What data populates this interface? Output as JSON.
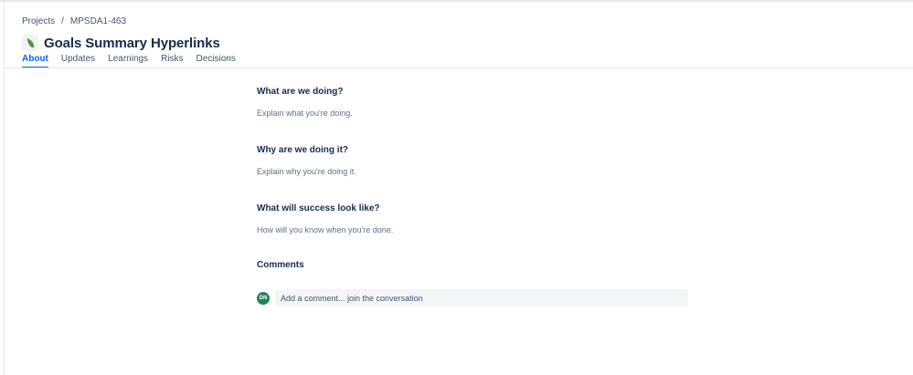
{
  "breadcrumb": {
    "items": [
      "Projects",
      "MPSDA1-463"
    ],
    "separator": "/"
  },
  "page": {
    "title": "Goals Summary Hyperlinks",
    "icon": "leaf-icon"
  },
  "tabs": [
    {
      "label": "About",
      "active": true
    },
    {
      "label": "Updates",
      "active": false
    },
    {
      "label": "Learnings",
      "active": false
    },
    {
      "label": "Risks",
      "active": false
    },
    {
      "label": "Decisions",
      "active": false
    }
  ],
  "sections": [
    {
      "heading": "What are we doing?",
      "placeholder": "Explain what you're doing."
    },
    {
      "heading": "Why are we doing it?",
      "placeholder": "Explain why you're doing it."
    },
    {
      "heading": "What will success look like?",
      "placeholder": "How will you know when you're done."
    }
  ],
  "comments": {
    "heading": "Comments",
    "avatar_initials": "DN",
    "input_placeholder": "Add a comment... join the conversation"
  },
  "colors": {
    "accent": "#0c66e4",
    "avatar_bg": "#1f845a",
    "icon_leaf": "#5b9a47"
  }
}
